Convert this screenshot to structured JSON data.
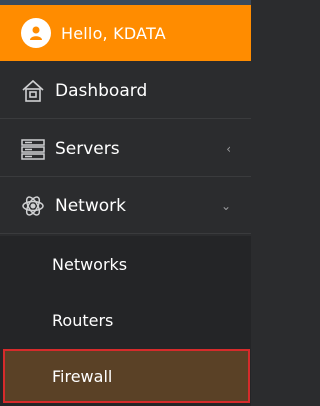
{
  "header": {
    "greeting": "Hello, KDATA"
  },
  "menu": {
    "dashboard": {
      "label": "Dashboard",
      "icon": "home-icon"
    },
    "servers": {
      "label": "Servers",
      "icon": "server-icon",
      "chevron": "‹"
    },
    "network": {
      "label": "Network",
      "icon": "network-icon",
      "chevron": "⌄"
    },
    "network_items": [
      {
        "label": "Networks"
      },
      {
        "label": "Routers"
      },
      {
        "label": "Firewall",
        "active": true
      }
    ]
  },
  "colors": {
    "accent": "#ff8c00",
    "sidebar_bg": "#2b2c2e",
    "submenu_bg": "#242527",
    "active_bg": "#5a4126",
    "highlight_border": "#d62b2b"
  }
}
